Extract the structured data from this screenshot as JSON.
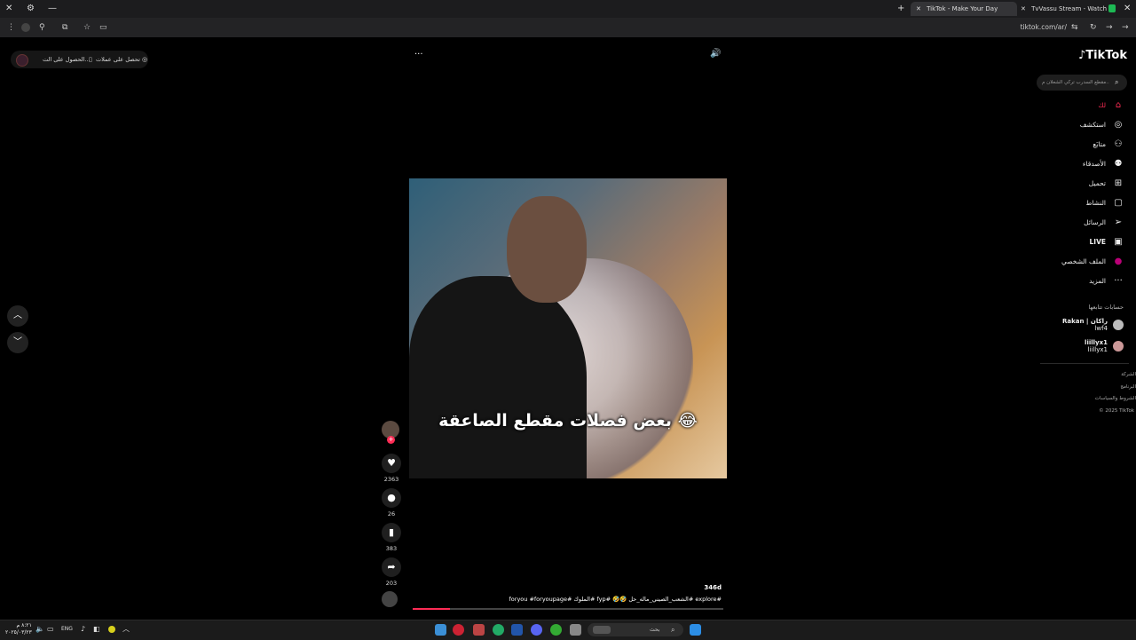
{
  "browser": {
    "tabs": [
      {
        "title": "TikTok - Make Your Day",
        "active": true
      },
      {
        "title": "TvVassu Stream - Watch Live on",
        "active": false
      }
    ],
    "new_tab": "+",
    "url": "tiktok.com/ar/"
  },
  "top_pill": {
    "item1": "تحصل على عملات",
    "item2": "الحصول على الت..."
  },
  "video_overlay": {
    "more": "···",
    "volume": "🔊"
  },
  "sidebar": {
    "logo": "TikTok",
    "search_placeholder": "مقطع السدرب تركي الشعلان م...",
    "items": [
      {
        "label": "لك",
        "icon": "home-icon"
      },
      {
        "label": "استكشف",
        "icon": "compass-icon"
      },
      {
        "label": "متابَع",
        "icon": "user-follow-icon"
      },
      {
        "label": "الأصدقاء",
        "icon": "friends-icon"
      },
      {
        "label": "تحميل",
        "icon": "upload-icon"
      },
      {
        "label": "النشاط",
        "icon": "activity-icon"
      },
      {
        "label": "الرسائل",
        "icon": "messages-icon"
      },
      {
        "label": "LIVE",
        "icon": "live-icon"
      },
      {
        "label": "الملف الشخصي",
        "icon": "profile-icon"
      },
      {
        "label": "المزيد",
        "icon": "more-icon"
      }
    ],
    "following_title": "حسابات تتابعها",
    "accounts": [
      {
        "name": "Rakan | راكان",
        "handle": "lwf4"
      },
      {
        "name": "liillyx1",
        "handle": "liillyx1"
      }
    ],
    "footer": [
      "الشركة",
      "البرنامج",
      "الشروط والسياسات",
      "© 2025 TikTok"
    ]
  },
  "video": {
    "caption_overlay": "😂 بعض فصلات مقطع الصاعقة",
    "likes": "2363",
    "comments": "26",
    "saves": "383",
    "shares": "203",
    "views_age": "346d",
    "hashtags": "#explore #الشعب_الصيني_ماله_حل 🤣🤣 #fyp #الملوك #foryou #foryoupage"
  },
  "taskbar": {
    "time": "٨:٢١ م",
    "date": "٢٠٢٥/٠٣/٢٣",
    "lang": "ENG",
    "search_label": "بحث"
  }
}
